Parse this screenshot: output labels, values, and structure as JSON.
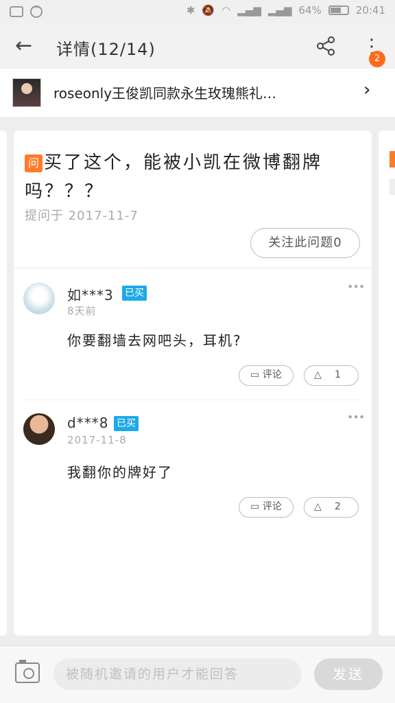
{
  "status_bar": {
    "battery": "64%",
    "battery_level": 0.64,
    "time": "20:41",
    "icons": [
      "image-icon",
      "circle-dots-icon",
      "bluetooth-icon",
      "mute-icon",
      "wifi-icon",
      "signal-icon",
      "signal-icon",
      "battery-icon"
    ]
  },
  "header": {
    "title": "详情(12/14)",
    "back_icon": "back-arrow-icon",
    "share_icon": "share-icon",
    "more_icon": "more-vertical-icon",
    "badge_count": "2",
    "badge_color": "#ff6a1a"
  },
  "product": {
    "name": "roseonly王俊凯同款永生玫瑰熊礼…"
  },
  "question": {
    "tag": "问",
    "text": "买了这个，能被小凯在微博翻牌吗？？？",
    "date": "提问于 2017-11-7",
    "follow_label": "关注此问题0",
    "tag_color": "#ff7a2a"
  },
  "answers": [
    {
      "user": "如***3",
      "badge": "已买",
      "time": "8天前",
      "text": "你要翻墙去网吧头，耳机?",
      "comment_label": "评论",
      "likes": "1"
    },
    {
      "user": "d***8",
      "badge": "已买",
      "time": "2017-11-8",
      "text": "我翻你的牌好了",
      "comment_label": "评论",
      "likes": "2"
    }
  ],
  "composer": {
    "placeholder": "被随机邀请的用户才能回答",
    "send_label": "发送"
  },
  "colors": {
    "bought_badge": "#1ea9e8",
    "accent": "#ff7a2a"
  }
}
